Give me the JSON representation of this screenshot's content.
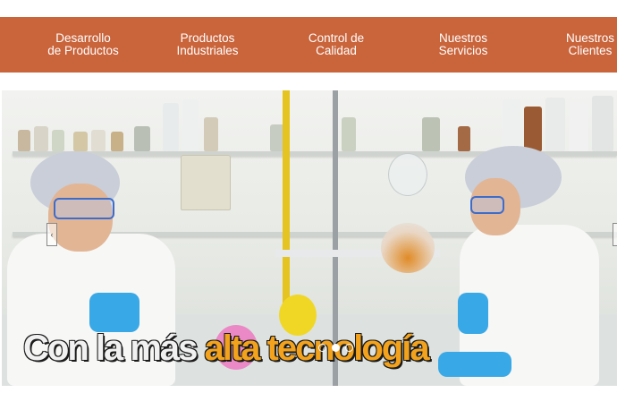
{
  "nav": {
    "items": [
      {
        "label": "Desarrollo\nde Productos"
      },
      {
        "label": "Productos\nIndustriales"
      },
      {
        "label": "Control de\nCalidad"
      },
      {
        "label": "Nuestros\nServicios"
      },
      {
        "label": "Nuestros\nClientes"
      }
    ],
    "color": "#c9643b"
  },
  "slider": {
    "caption_white": "Con la más ",
    "caption_orange": "alta tecnología",
    "accent_color": "#f2a21c",
    "slide_count": 3,
    "active_slide": 2
  }
}
